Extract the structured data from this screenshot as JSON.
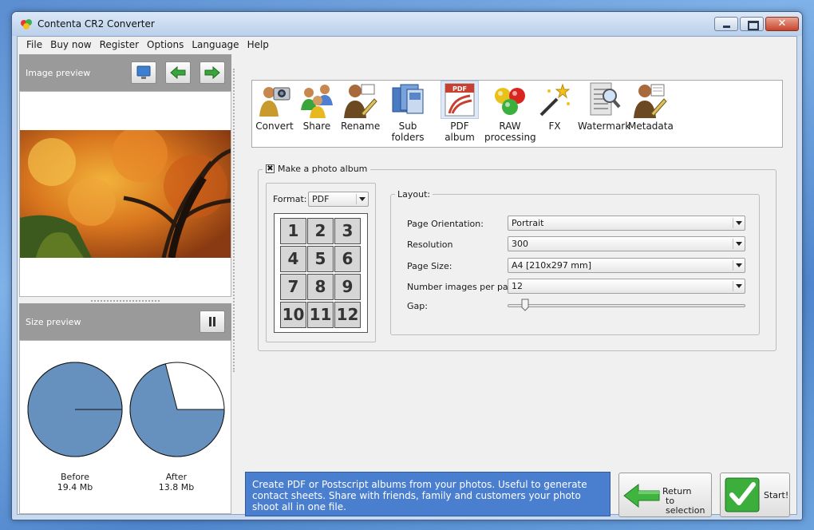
{
  "window": {
    "title": "Contenta CR2 Converter",
    "close_glyph": "✕"
  },
  "menu": [
    "File",
    "Buy now",
    "Register",
    "Options",
    "Language",
    "Help"
  ],
  "image_preview": {
    "label": "Image preview"
  },
  "size_preview": {
    "label": "Size preview",
    "before_label": "Before",
    "before_size": "19.4 Mb",
    "after_label": "After",
    "after_size": "13.8 Mb",
    "before_fraction": 1.0,
    "after_fraction": 0.71,
    "pie_color": "#6690be"
  },
  "toolbar": [
    {
      "label": "Convert",
      "icon": "camera-person-icon"
    },
    {
      "label": "Share",
      "icon": "people-icon"
    },
    {
      "label": "Rename",
      "icon": "person-pen-icon"
    },
    {
      "label": "Sub folders",
      "icon": "folders-icon"
    },
    {
      "label": "PDF album",
      "icon": "pdf-icon"
    },
    {
      "label": "RAW",
      "label2": "processing",
      "icon": "color-balls-icon"
    },
    {
      "label": "FX",
      "icon": "magic-wand-icon"
    },
    {
      "label": "Watermark",
      "icon": "watermark-magnifier-icon"
    },
    {
      "label": "Metadata",
      "icon": "person-document-icon"
    }
  ],
  "album": {
    "make_album_label": "Make a photo album",
    "checked_glyph": "✖",
    "format_label": "Format:",
    "format_value": "PDF",
    "grid_numbers": [
      "1",
      "2",
      "3",
      "4",
      "5",
      "6",
      "7",
      "8",
      "9",
      "10",
      "11",
      "12"
    ],
    "layout": {
      "title": "Layout:",
      "orientation_label": "Page Orientation:",
      "orientation_value": "Portrait",
      "resolution_label": "Resolution",
      "resolution_value": "300",
      "page_size_label": "Page Size:",
      "page_size_value": "A4 [210x297 mm]",
      "images_per_page_label": "Number images per page:",
      "images_per_page_value": "12",
      "gap_label": "Gap:"
    }
  },
  "info_text": "Create PDF or Postscript albums from your photos. Useful to generate contact sheets. Share with friends, family and customers your photo shoot all in one file.",
  "buttons": {
    "return_line1": "Return",
    "return_line2": "to selection",
    "start": "Start!"
  }
}
